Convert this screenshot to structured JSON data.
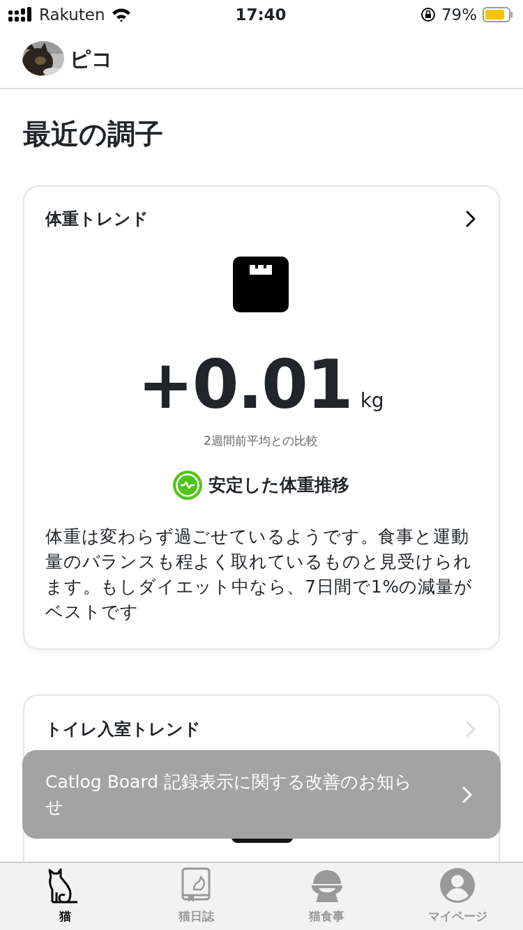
{
  "status_bar": {
    "carrier": "Rakuten",
    "time": "17:40",
    "battery_text": "79%"
  },
  "header": {
    "name": "ピコ"
  },
  "page_title": "最近の調子",
  "cards": [
    {
      "title": "体重トレンド",
      "value": "+0.01",
      "unit": "kg",
      "caption": "2週間前平均との比較",
      "status": "安定した体重推移",
      "description": "体重は変わらず過ごせているようです。食事と運動量のバランスも程よく取れているものと見受けられます。もしダイエット中なら、7日間で1%の減量がベストです"
    },
    {
      "title": "トイレ入室トレンド"
    }
  ],
  "toast": {
    "text": "Catlog Board 記録表示に関する改善のお知らせ"
  },
  "tabs": [
    {
      "label": "猫",
      "selected": true
    },
    {
      "label": "猫日誌",
      "selected": false
    },
    {
      "label": "猫食事",
      "selected": false
    },
    {
      "label": "マイページ",
      "selected": false
    }
  ]
}
